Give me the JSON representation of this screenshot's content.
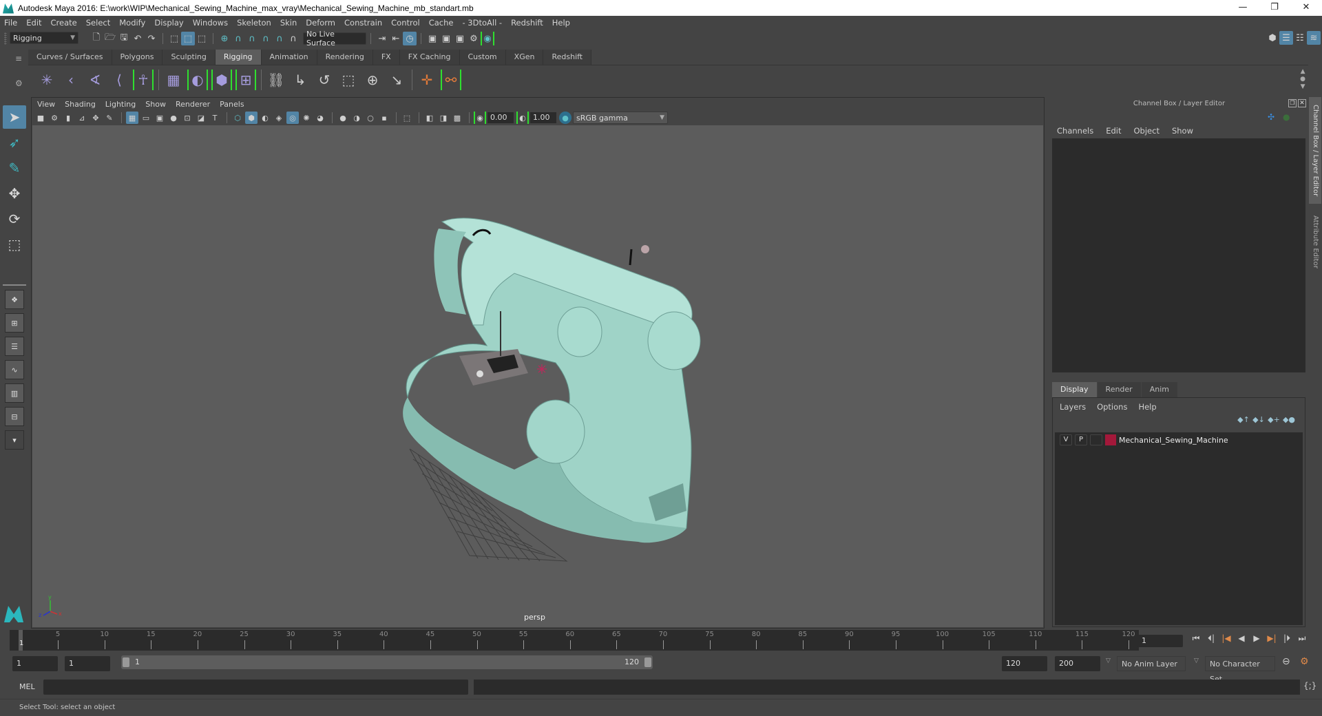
{
  "window": {
    "title": "Autodesk Maya 2016: E:\\work\\WIP\\Mechanical_Sewing_Machine_max_vray\\Mechanical_Sewing_Machine_mb_standart.mb",
    "minimize": "—",
    "restore": "❐",
    "close": "✕"
  },
  "menubar": [
    "File",
    "Edit",
    "Create",
    "Select",
    "Modify",
    "Display",
    "Windows",
    "Skeleton",
    "Skin",
    "Deform",
    "Constrain",
    "Control",
    "Cache",
    "- 3DtoAll -",
    "Redshift",
    "Help"
  ],
  "statusline": {
    "menuset": "Rigging",
    "live_surface": "No Live Surface"
  },
  "shelf": {
    "tabs": [
      "Curves / Surfaces",
      "Polygons",
      "Sculpting",
      "Rigging",
      "Animation",
      "Rendering",
      "FX",
      "FX Caching",
      "Custom",
      "XGen",
      "Redshift"
    ],
    "active_tab": "Rigging"
  },
  "viewport": {
    "menu": [
      "View",
      "Shading",
      "Lighting",
      "Show",
      "Renderer",
      "Panels"
    ],
    "exposure": "0.00",
    "gamma": "1.00",
    "color_space": "sRGB gamma",
    "camera_label": "persp",
    "model_color": "#9fd3c7"
  },
  "channel_box": {
    "title": "Channel Box / Layer Editor",
    "menu": [
      "Channels",
      "Edit",
      "Object",
      "Show"
    ]
  },
  "layer_editor": {
    "tabs": [
      "Display",
      "Render",
      "Anim"
    ],
    "active_tab": "Display",
    "menu": [
      "Layers",
      "Options",
      "Help"
    ],
    "layers": [
      {
        "visible": "V",
        "playback": "P",
        "color": "#a3183a",
        "name": "Mechanical_Sewing_Machine"
      }
    ]
  },
  "side_tabs": [
    "Channel Box / Layer Editor",
    "Attribute Editor"
  ],
  "timeline": {
    "ticks": [
      5,
      10,
      15,
      20,
      25,
      30,
      35,
      40,
      45,
      50,
      55,
      60,
      65,
      70,
      75,
      80,
      85,
      90,
      95,
      100,
      105,
      110,
      115,
      120
    ],
    "min": 1,
    "max": 120,
    "current_frame": "1",
    "current_frame_field": "1"
  },
  "range": {
    "start": "1",
    "playback_start": "1",
    "slider_start": "1",
    "slider_end": "120",
    "playback_end": "120",
    "end": "200",
    "anim_layer": "No Anim Layer",
    "character_set": "No Character Set"
  },
  "mel": {
    "label": "MEL"
  },
  "help_line": "Select Tool: select an object"
}
